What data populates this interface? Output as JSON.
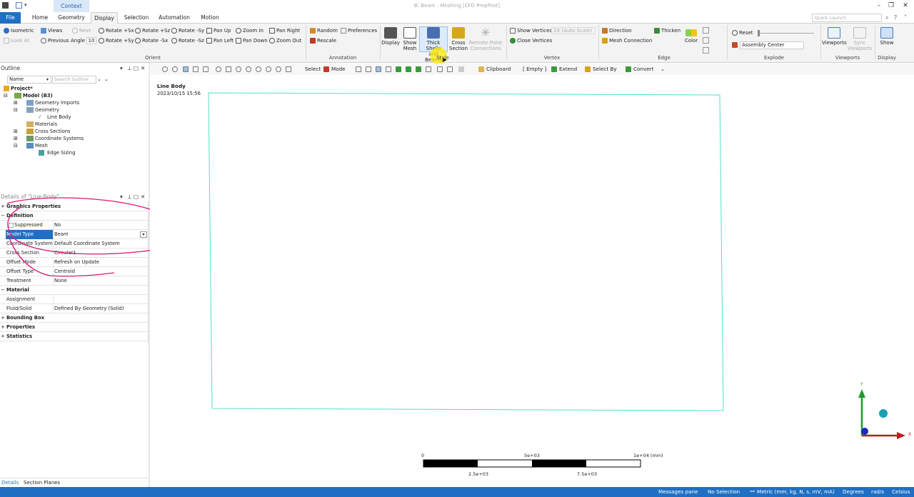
{
  "titlebar": {
    "context_tab": "Context",
    "title": "B: Beam - Meshing [CFD PrepPost]",
    "minimize": "–",
    "restore": "❐",
    "close": "✕"
  },
  "tabs": {
    "file": "File",
    "home": "Home",
    "geometry": "Geometry",
    "display": "Display",
    "selection": "Selection",
    "automation": "Automation",
    "motion": "Motion",
    "quick_launch": "Quick Launch"
  },
  "ribbon": {
    "orient": {
      "isometric": "Isometric",
      "views": "Views",
      "next": "Next",
      "look_at": "Look At",
      "previous": "Previous",
      "angle_label": "Angle",
      "angle_value": "10",
      "rot1": "Rotate +Sx",
      "rot2": "Rotate +Sz",
      "rot3": "Rotate -Sy",
      "rot4": "Rotate +Sy",
      "rot5": "Rotate -Sx",
      "rot6": "Rotate -Sz",
      "pan_up": "Pan Up",
      "pan_left": "Pan Left",
      "zoom_in": "Zoom In",
      "pan_down": "Pan Down",
      "pan_right": "Pan Right",
      "zoom_out": "Zoom Out",
      "group": "Orient"
    },
    "annotation": {
      "random": "Random",
      "preferences": "Preferences",
      "rescale": "Rescale",
      "group": "Annotation"
    },
    "style": {
      "display": "Display",
      "show_mesh_1": "Show",
      "show_mesh_2": "Mesh",
      "thick_1": "Thick Shells",
      "thick_2": "and Beams",
      "cross_1": "Cross",
      "cross_2": "Section",
      "remote_1": "Remote Point",
      "remote_2": "Connections",
      "group": "Style"
    },
    "vertex": {
      "show_vertices": "Show Vertices",
      "scale": "2X (Auto Scale)",
      "close_vertices": "Close Vertices",
      "group": "Vertex"
    },
    "edge": {
      "direction": "Direction",
      "mesh_connection": "Mesh Connection",
      "thicken": "Thicken",
      "color": "Color",
      "group": "Edge"
    },
    "explode": {
      "reset": "Reset",
      "assembly_center": "Assembly Center",
      "group": "Explode"
    },
    "viewports": {
      "viewports": "Viewports",
      "sync_1": "Sync",
      "sync_2": "Viewports",
      "group": "Viewports"
    },
    "display_group": {
      "show": "Show",
      "group": "Display"
    }
  },
  "outline": {
    "title": "Outline",
    "name_filter": "Name",
    "search_placeholder": "Search Outline",
    "tree": [
      "Project*",
      "Model (B3)",
      "Geometry Imports",
      "Geometry",
      "Line Body",
      "Materials",
      "Cross Sections",
      "Coordinate Systems",
      "Mesh",
      "Edge Sizing"
    ]
  },
  "details": {
    "title": "Details of \"Line Body\"",
    "rows": [
      {
        "k": "Graphics Properties",
        "v": "",
        "section": true,
        "pm": "+"
      },
      {
        "k": "Definition",
        "v": "",
        "section": true,
        "pm": "−"
      },
      {
        "k": "Suppressed",
        "v": "No"
      },
      {
        "k": "Model Type",
        "v": "Beam",
        "selected": true
      },
      {
        "k": "Coordinate System",
        "v": "Default Coordinate System"
      },
      {
        "k": "Cross Section",
        "v": "Circular1"
      },
      {
        "k": "Offset Mode",
        "v": "Refresh on Update"
      },
      {
        "k": "Offset Type",
        "v": "Centroid"
      },
      {
        "k": "Treatment",
        "v": "None"
      },
      {
        "k": "Material",
        "v": "",
        "section": true,
        "pm": "−"
      },
      {
        "k": "Assignment",
        "v": ""
      },
      {
        "k": "Fluid/Solid",
        "v": "Defined By Geometry (Solid)"
      },
      {
        "k": "Bounding Box",
        "v": "",
        "section": true,
        "pm": "+"
      },
      {
        "k": "Properties",
        "v": "",
        "section": true,
        "pm": "+"
      },
      {
        "k": "Statistics",
        "v": "",
        "section": true,
        "pm": "+"
      }
    ],
    "bottom_tabs": [
      "Details",
      "Section Planes"
    ]
  },
  "toolbar": {
    "select": "Select",
    "mode": "Mode",
    "clipboard": "Clipboard",
    "empty": "[ Empty ]",
    "extend": "Extend",
    "select_by": "Select By",
    "convert": "Convert"
  },
  "viewport": {
    "object_name": "Line Body",
    "timestamp": "2023/10/15 15:56",
    "scale_labels": [
      "0",
      "5e+03",
      "1e+04 (mm)",
      "2.5e+03",
      "7.5e+03"
    ],
    "axis_y": "Y",
    "axis_x": "X"
  },
  "status": {
    "messages": "Messages pane",
    "selection": "No Selection",
    "units": "Metric (mm, kg, N, s, mV, mA)",
    "degrees": "Degrees",
    "rads": "rad/s",
    "celsius": "Celsius"
  },
  "colors": {
    "accent": "#1f6fc4",
    "body_outline": "#4fe3c4",
    "annotation_ink": "#e0157a",
    "highlight": "#ffe900"
  }
}
